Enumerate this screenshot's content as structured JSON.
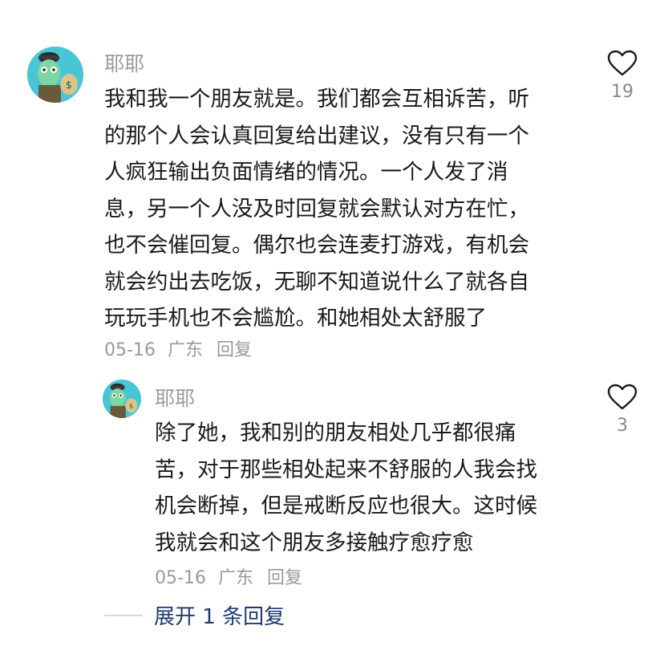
{
  "comment": {
    "username": "耶耶",
    "lines": [
      "我和我一个朋友就是。我们都会互相诉苦，听",
      "的那个人会认真回复给出建议，没有只有一个",
      "人疯狂输出负面情绪的情况。一个人发了消",
      "息，另一个人没及时回复就会默认对方在忙，",
      "也不会催回复。偶尔也会连麦打游戏，有机会",
      "就会约出去吃饭，无聊不知道说什么了就各自",
      "玩玩手机也不会尴尬。和她相处太舒服了"
    ],
    "date": "05-16",
    "location": "广东",
    "reply_label": "回复",
    "like_count": "19"
  },
  "reply": {
    "username": "耶耶",
    "lines": [
      "除了她，我和别的朋友相处几乎都很痛",
      "苦，对于那些相处起来不舒服的人我会找",
      "机会断掉，但是戒断反应也很大。这时候",
      "我就会和这个朋友多接触疗愈疗愈"
    ],
    "date": "05-16",
    "location": "广东",
    "reply_label": "回复",
    "like_count": "3"
  },
  "expand": {
    "label": "展开 1 条回复"
  },
  "colors": {
    "text": "#1a1a1a",
    "muted": "#9a9a9a",
    "link": "#1f3b6e",
    "avatar_bg": "#3fbfd0"
  },
  "icons": {
    "like": "heart-outline-icon",
    "avatar": "cartoon-character-avatar"
  }
}
